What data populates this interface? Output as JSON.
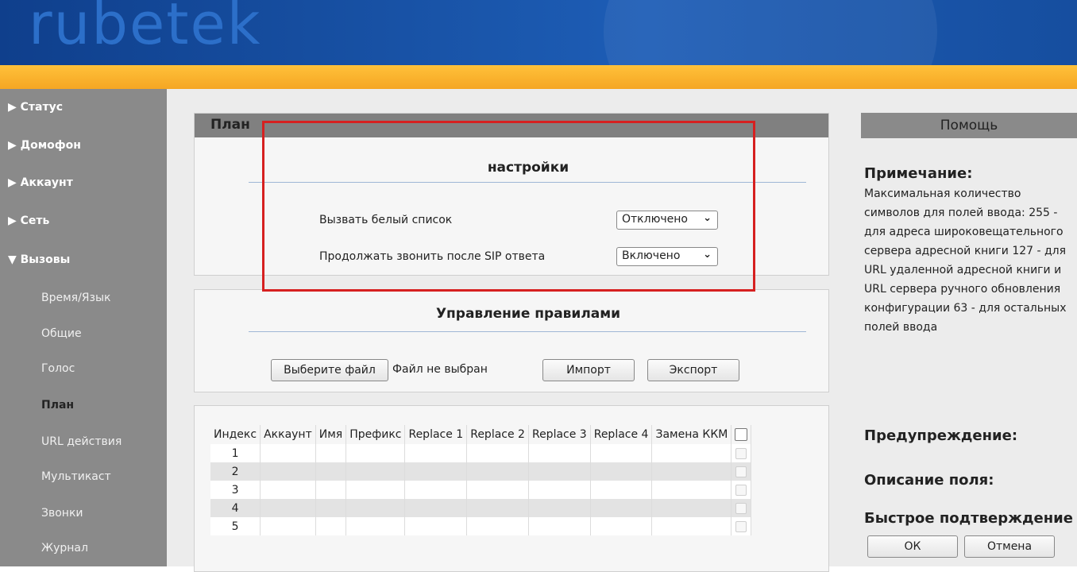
{
  "header": {
    "logo_text": "rubetek"
  },
  "colors": {
    "header_blue": "#1a56ab",
    "accent_orange": "#f5a623",
    "sidebar_gray": "#8a8a8a",
    "highlight_red": "#d62020"
  },
  "sidebar": {
    "items": [
      {
        "label": "▶ Статус"
      },
      {
        "label": "▶ Домофон"
      },
      {
        "label": "▶ Аккаунт"
      },
      {
        "label": "▶ Сеть"
      },
      {
        "label": "▼ Вызовы"
      }
    ],
    "subitems": [
      {
        "label": "Время/Язык"
      },
      {
        "label": "Общие"
      },
      {
        "label": "Голос"
      },
      {
        "label": "План"
      },
      {
        "label": "URL действия"
      },
      {
        "label": "Мультикаст"
      },
      {
        "label": "Звонки"
      },
      {
        "label": "Журнал"
      }
    ]
  },
  "plan": {
    "title": "План",
    "settings_title": "настройки",
    "rows": [
      {
        "label": "Вызвать белый список",
        "value": "Отключено"
      },
      {
        "label": "Продолжать звонить после SIP ответа",
        "value": "Включено"
      }
    ]
  },
  "rules": {
    "title": "Управление правилами",
    "choose_file": "Выберите файл",
    "no_file": "Файл не выбран",
    "import": "Импорт",
    "export": "Экспорт"
  },
  "table": {
    "headers": [
      "Индекс",
      "Аккаунт",
      "Имя",
      "Префикс",
      "Replace 1",
      "Replace 2",
      "Replace 3",
      "Replace 4",
      "Замена ККМ"
    ],
    "rows": [
      "1",
      "2",
      "3",
      "4",
      "5"
    ]
  },
  "help": {
    "title": "Помощь",
    "note_title": "Примечание:",
    "note_text": "Максимальная количество символов для полей ввода: 255 - для адреса широковещательного сервера адресной книги 127 - для URL удаленной адресной книги и URL сервера ручного обновления конфигурации 63 - для остальных полей ввода",
    "warning_title": "Предупреждение:",
    "field_title": "Описание поля:",
    "quick_confirm": "Быстрое подтверждение",
    "ok": "ОК",
    "cancel": "Отмена"
  }
}
